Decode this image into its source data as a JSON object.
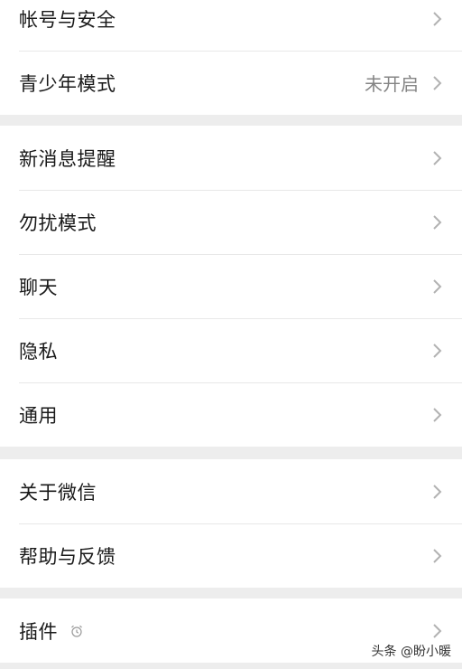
{
  "groups": [
    {
      "rows": [
        {
          "label": "帐号与安全",
          "value": ""
        },
        {
          "label": "青少年模式",
          "value": "未开启"
        }
      ]
    },
    {
      "rows": [
        {
          "label": "新消息提醒",
          "value": ""
        },
        {
          "label": "勿扰模式",
          "value": ""
        },
        {
          "label": "聊天",
          "value": ""
        },
        {
          "label": "隐私",
          "value": ""
        },
        {
          "label": "通用",
          "value": ""
        }
      ]
    },
    {
      "rows": [
        {
          "label": "关于微信",
          "value": ""
        },
        {
          "label": "帮助与反馈",
          "value": ""
        }
      ]
    },
    {
      "rows": [
        {
          "label": "插件",
          "value": "",
          "icon": "alarm-clock-icon"
        }
      ]
    }
  ],
  "watermark": "头条 @盼小暖",
  "colors": {
    "background": "#ededed",
    "cell": "#ffffff",
    "text": "#191919",
    "secondary": "#858585",
    "chevron": "#b2b2b2"
  }
}
